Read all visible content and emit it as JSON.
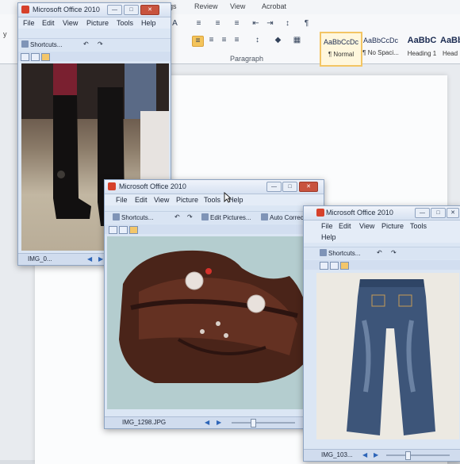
{
  "ribbon": {
    "tabs": [
      "ngs",
      "Review",
      "View",
      "Acrobat"
    ],
    "group_label": "Paragraph",
    "styles": [
      {
        "preview": "AaBbCcDc",
        "name": "¶ Normal"
      },
      {
        "preview": "AaBbCcDc",
        "name": "¶ No Spaci..."
      },
      {
        "preview": "AaBbC",
        "name": "Heading 1"
      },
      {
        "preview": "AaBbC",
        "name": "Head"
      }
    ],
    "left_edge_text": "y"
  },
  "windows": {
    "boots": {
      "title": "Microsoft Office 2010",
      "menus": [
        "File",
        "Edit",
        "View",
        "Picture",
        "Tools",
        "Help"
      ],
      "toolbar": {
        "shortcuts": "Shortcuts..."
      },
      "filename": "IMG_0..."
    },
    "bag": {
      "title": "Microsoft Office 2010",
      "menus": [
        "File",
        "Edit",
        "View",
        "Picture",
        "Tools",
        "Help"
      ],
      "toolbar": {
        "shortcuts": "Shortcuts...",
        "edit": "Edit Pictures...",
        "auto": "Auto Correct"
      },
      "filename": "IMG_1298.JPG"
    },
    "jeans": {
      "title": "Microsoft Office 2010",
      "menus": [
        "File",
        "Edit",
        "View",
        "Picture",
        "Tools",
        "Help"
      ],
      "toolbar": {
        "shortcuts": "Shortcuts..."
      },
      "filename": "IMG_103..."
    }
  },
  "colors": {
    "accent": "#f4c45b",
    "close": "#c8533e"
  }
}
